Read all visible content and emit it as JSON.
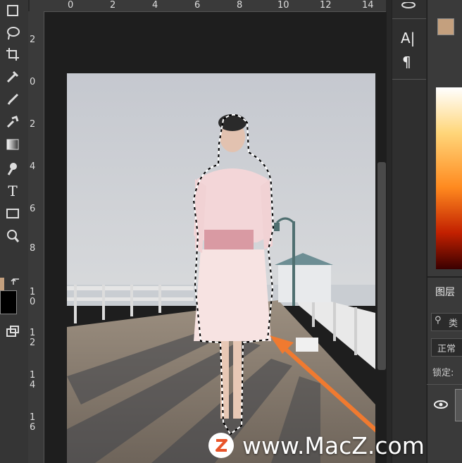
{
  "rulers": {
    "top": [
      "0",
      "2",
      "4",
      "6",
      "8",
      "10",
      "12",
      "14"
    ],
    "left": [
      "2",
      "0",
      "2",
      "4",
      "6",
      "8",
      "1 0",
      "1 2",
      "1 4",
      "1 6"
    ]
  },
  "text_tool_glyph": "T",
  "char_panel": {
    "char_icon": "A|",
    "para_icon": "¶"
  },
  "layers": {
    "tab_label": "图层",
    "search_label": "类",
    "blend_label": "正常",
    "lock_label": "锁定:"
  },
  "watermark": {
    "text": "www.MacZ.com"
  },
  "colors": {
    "foreground": "#c4a07e",
    "background": "#000000",
    "accent_arrow": "#f07a30"
  }
}
